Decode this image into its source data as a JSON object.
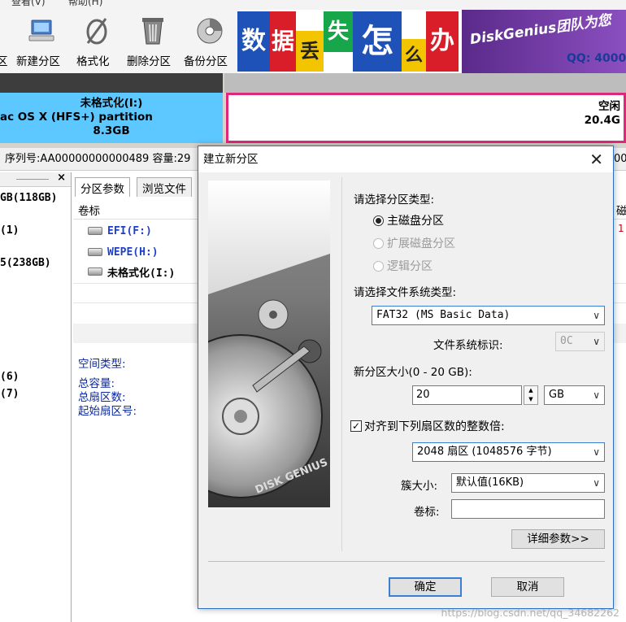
{
  "menu": {
    "items": [
      "查看(V)",
      "帮助(H)"
    ]
  },
  "toolbar": {
    "items": [
      {
        "label": "区",
        "icon": "partition-icon"
      },
      {
        "label": "新建分区",
        "icon": "computer-icon"
      },
      {
        "label": "格式化",
        "icon": "format-icon"
      },
      {
        "label": "删除分区",
        "icon": "trash-icon"
      },
      {
        "label": "备份分区",
        "icon": "backup-disc-icon"
      }
    ]
  },
  "banner": {
    "tiles": [
      "数",
      "据",
      "丢",
      "失",
      "怎",
      "么",
      "办"
    ],
    "logo": "DiskGenius团队为您",
    "qq": "QQ: 4000"
  },
  "disk_map": {
    "p1_name": "未格式化(I:)",
    "p1_fs": "ac OS X (HFS+) partition",
    "p1_size": "8.3GB",
    "p2_name": "空闲",
    "p2_size": "20.4G"
  },
  "info_bar": {
    "text": "序列号:AA00000000000489  容量:29",
    "tail": "00"
  },
  "left_panel": {
    "close": "×",
    "items": [
      "GB(118GB)",
      "(1)",
      "5(238GB)",
      "(6)",
      "(7)"
    ]
  },
  "right_panel": {
    "tabs": [
      "分区参数",
      "浏览文件"
    ],
    "col_volume": "卷标",
    "col_right": "磁",
    "rows": [
      "EFI(F:)",
      "WEPE(H:)",
      "未格式化(I:)"
    ],
    "edge_mark": "1",
    "space_type": "空间类型:",
    "props": [
      "总容量:",
      "总扇区数:",
      "起始扇区号:"
    ]
  },
  "dialog": {
    "title": "建立新分区",
    "close": "✕",
    "partition_type_label": "请选择分区类型:",
    "partition_types": [
      {
        "label": "主磁盘分区",
        "selected": true,
        "enabled": true
      },
      {
        "label": "扩展磁盘分区",
        "selected": false,
        "enabled": false
      },
      {
        "label": "逻辑分区",
        "selected": false,
        "enabled": false
      }
    ],
    "fs_type_label": "请选择文件系统类型:",
    "fs_type_value": "FAT32 (MS Basic Data)",
    "fs_id_label": "文件系统标识:",
    "fs_id_value": "0C",
    "size_label": "新分区大小(0 - 20 GB):",
    "size_value": "20",
    "size_unit": "GB",
    "align_label": "对齐到下列扇区数的整数倍:",
    "align_checked": true,
    "align_value": "2048 扇区 (1048576 字节)",
    "cluster_label": "簇大小:",
    "cluster_value": "默认值(16KB)",
    "volume_label": "卷标:",
    "volume_value": "",
    "detail_button": "详细参数>>",
    "ok_button": "确定",
    "cancel_button": "取消",
    "image_text": "DISK GENIUS"
  },
  "watermark": "https://blog.csdn.net/qq_34682262",
  "colors": {
    "accent": "#3c7fd0",
    "partition_blue": "#5cc8ff",
    "free_border": "#e0287a",
    "label_blue": "#0a28a0"
  }
}
